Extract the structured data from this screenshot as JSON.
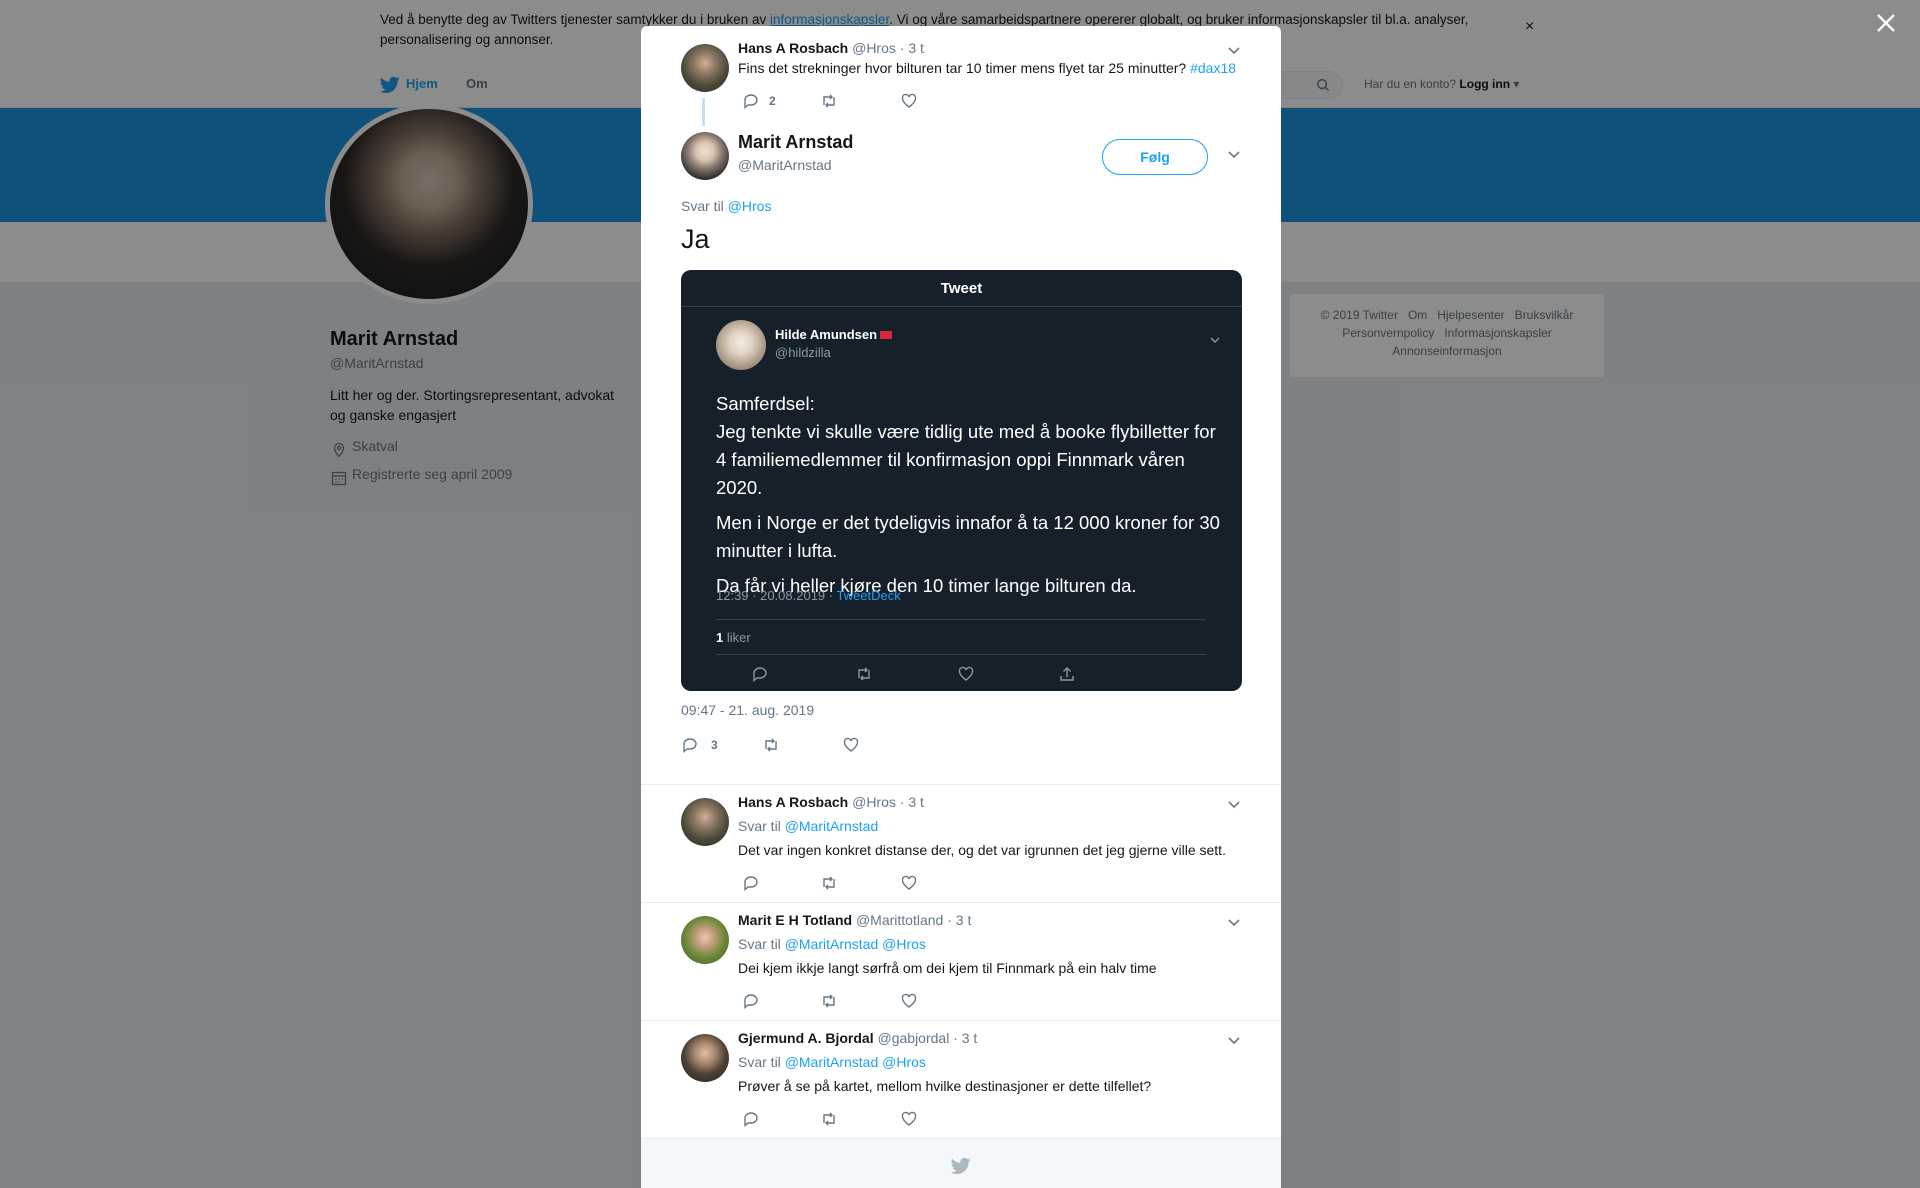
{
  "cookie": {
    "text_before": "Ved å benytte deg av Twitters tjenester samtykker du i bruken av ",
    "link": "informasjonskapsler",
    "text_after": ". Vi og våre samarbeidspartnere opererer globalt, og bruker informasjonskapsler til bl.a. analyser, personalisering og annonser.",
    "close": "×"
  },
  "nav": {
    "home": "Hjem",
    "about": "Om",
    "account_prompt": "Har du en konto?",
    "login": "Logg inn"
  },
  "profile": {
    "name": "Marit Arnstad",
    "handle": "@MaritArnstad",
    "bio": "Litt her og der. Stortingsrepresentant, advokat og ganske engasjert",
    "location": "Skatval",
    "joined": "Registrerte seg april 2009"
  },
  "footer_links": [
    "© 2019 Twitter",
    "Om",
    "Hjelpesenter",
    "Bruksvilkår",
    "Personvernpolicy",
    "Informasjonskapsler",
    "Annonseinformasjon"
  ],
  "parent_tweet": {
    "name": "Hans A Rosbach",
    "handle": "@Hros",
    "time": "· 3 t",
    "text": "Fins det strekninger hvor bilturen tar 10 timer mens flyet tar 25 minutter?",
    "hashtag": "#dax18",
    "reply_count": "2"
  },
  "main_tweet": {
    "name": "Marit Arnstad",
    "handle": "@MaritArnstad",
    "follow": "Følg",
    "reply_prefix": "Svar til",
    "reply_to": "@Hros",
    "text": "Ja",
    "timestamp": "09:47 - 21. aug. 2019",
    "reply_count": "3"
  },
  "embed": {
    "header": "Tweet",
    "name": "Hilde Amundsen",
    "handle": "@hildzilla",
    "lines": [
      "Samferdsel:\nJeg tenkte vi skulle være tidlig ute med å booke flybilletter for 4 familiemedlemmer til konfirmasjon oppi Finnmark våren 2020.",
      "Men i Norge er det tydeligvis innafor å ta 12 000 kroner for 30 minutter i lufta.",
      "Da får vi heller kjøre den 10 timer lange bilturen da."
    ],
    "time": "12:39 · 20.08.2019 · ",
    "source": "TweetDeck",
    "likes_count": "1",
    "likes_label": "liker"
  },
  "replies": [
    {
      "name": "Hans A Rosbach",
      "handle": "@Hros",
      "time": "· 3 t",
      "reply_prefix": "Svar til",
      "reply_to": "@MaritArnstad",
      "text": "Det var ingen konkret distanse der, og det var igrunnen det jeg gjerne ville sett."
    },
    {
      "name": "Marit E H Totland",
      "handle": "@Marittotland",
      "time": "· 3 t",
      "reply_prefix": "Svar til",
      "reply_to": "@MaritArnstad @Hros",
      "text": "Dei kjem ikkje langt sørfrå om dei kjem til Finnmark på ein halv time"
    },
    {
      "name": "Gjermund A. Bjordal",
      "handle": "@gabjordal",
      "time": "· 3 t",
      "reply_prefix": "Svar til",
      "reply_to": "@MaritArnstad @Hros",
      "text": "Prøver å se på kartet, mellom hvilke destinasjoner er dette tilfellet?"
    }
  ],
  "colors": {
    "accent": "#1da1f2",
    "banner": "#1b95e0",
    "embed_bg": "#15202b",
    "muted": "#657786"
  },
  "icons": [
    "twitter-bird-icon",
    "search-icon",
    "location-icon",
    "calendar-icon",
    "close-icon",
    "chevron-down-icon",
    "reply-icon",
    "retweet-icon",
    "like-icon",
    "share-icon"
  ]
}
